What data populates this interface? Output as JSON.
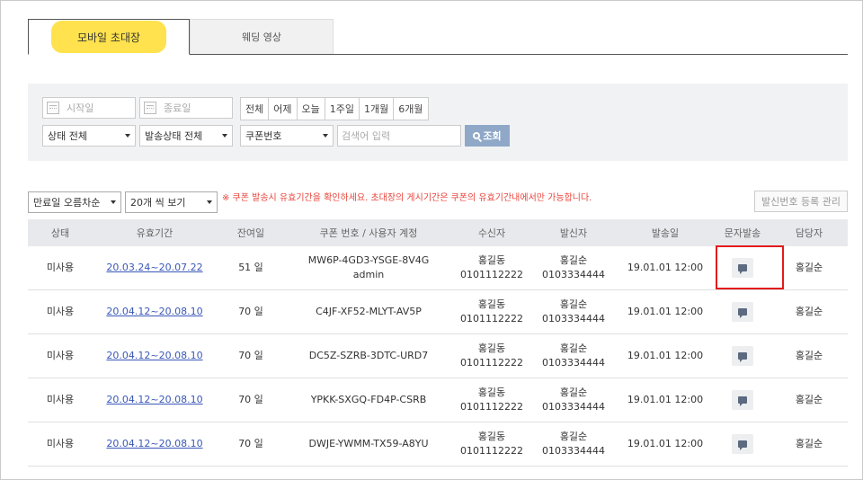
{
  "tabs": [
    {
      "label": "모바일 초대장"
    },
    {
      "label": "웨딩 영상"
    }
  ],
  "filter": {
    "start_placeholder": "시작일",
    "end_placeholder": "종료일",
    "ranges": [
      "전체",
      "어제",
      "오늘",
      "1주일",
      "1개월",
      "6개월"
    ],
    "status_select": "상태 전체",
    "send_status_select": "발송상태 전체",
    "search_type_select": "쿠폰번호",
    "keyword_placeholder": "검색어 입력",
    "search_button": "조회"
  },
  "controls": {
    "sort_select": "만료일 오름차순",
    "page_size_select": "20개 씩 보기",
    "notice": "※ 쿠폰 발송시 유효기간을 확인하세요. 초대장의 게시기간은 쿠폰의 유효기간내에서만 가능합니다.",
    "register_button": "발신번호 등록 관리"
  },
  "table": {
    "headers": [
      "상태",
      "유효기간",
      "잔여일",
      "쿠폰 번호 / 사용자 계정",
      "수신자",
      "발신자",
      "발송일",
      "문자발송",
      "담당자"
    ],
    "rows": [
      {
        "status": "미사용",
        "period": "20.03.24~20.07.22",
        "days": "51 일",
        "coupon": "MW6P-4GD3-YSGE-8V4G",
        "account": "admin",
        "recv_name": "홍길동",
        "recv_phone": "0101112222",
        "send_name": "홍길순",
        "send_phone": "0103334444",
        "date": "19.01.01 12:00",
        "manager": "홍길순"
      },
      {
        "status": "미사용",
        "period": "20.04.12~20.08.10",
        "days": "70 일",
        "coupon": "C4JF-XF52-MLYT-AV5P",
        "account": "",
        "recv_name": "홍길동",
        "recv_phone": "0101112222",
        "send_name": "홍길순",
        "send_phone": "0103334444",
        "date": "19.01.01 12:00",
        "manager": "홍길순"
      },
      {
        "status": "미사용",
        "period": "20.04.12~20.08.10",
        "days": "70 일",
        "coupon": "DC5Z-SZRB-3DTC-URD7",
        "account": "",
        "recv_name": "홍길동",
        "recv_phone": "0101112222",
        "send_name": "홍길순",
        "send_phone": "0103334444",
        "date": "19.01.01 12:00",
        "manager": "홍길순"
      },
      {
        "status": "미사용",
        "period": "20.04.12~20.08.10",
        "days": "70 일",
        "coupon": "YPKK-SXGQ-FD4P-CSRB",
        "account": "",
        "recv_name": "홍길동",
        "recv_phone": "0101112222",
        "send_name": "홍길순",
        "send_phone": "0103334444",
        "date": "19.01.01 12:00",
        "manager": "홍길순"
      },
      {
        "status": "미사용",
        "period": "20.04.12~20.08.10",
        "days": "70 일",
        "coupon": "DWJE-YWMM-TX59-A8YU",
        "account": "",
        "recv_name": "홍길동",
        "recv_phone": "0101112222",
        "send_name": "홍길순",
        "send_phone": "0103334444",
        "date": "19.01.01 12:00",
        "manager": "홍길순"
      }
    ]
  },
  "colors": {
    "tab_highlight": "#ffe24d",
    "search_button": "#8fa8c8",
    "notice": "#e8443a",
    "highlight_box": "#e31b1b",
    "link": "#3a58b8"
  }
}
